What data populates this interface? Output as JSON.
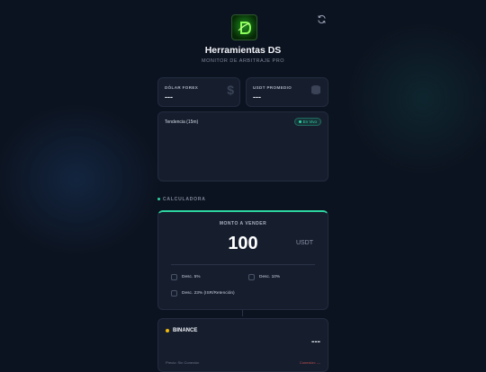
{
  "header": {
    "title": "Herramientas DS",
    "subtitle": "MONITOR DE ARBITRAJE PRO",
    "logo_text": "DS"
  },
  "stats": [
    {
      "label": "DÓLAR FOREX",
      "value": "---",
      "icon": "dollar-icon"
    },
    {
      "label": "USDT PROMEDIO",
      "value": "---",
      "icon": "coins-icon"
    }
  ],
  "trend": {
    "label": "Tendencia (15m)",
    "badge": "En Vivo"
  },
  "calculator": {
    "section_title": "CALCULADORA",
    "amount_label": "MONTO A VENDER",
    "amount": "100",
    "unit": "USDT",
    "options": [
      {
        "label": "Desc. 5%",
        "checked": false
      },
      {
        "label": "Desc. 10%",
        "checked": false
      },
      {
        "label": "Desc. 23% (ISR/Retención)",
        "checked": false
      }
    ]
  },
  "exchange": {
    "name": "BINANCE",
    "value": "---",
    "status_left": "Precio: Sin Conexión",
    "status_right": "Conexión: ---"
  },
  "colors": {
    "accent": "#2dd4a0",
    "binance": "#f0b90b",
    "background": "#0c1320",
    "card": "#161e2e"
  }
}
